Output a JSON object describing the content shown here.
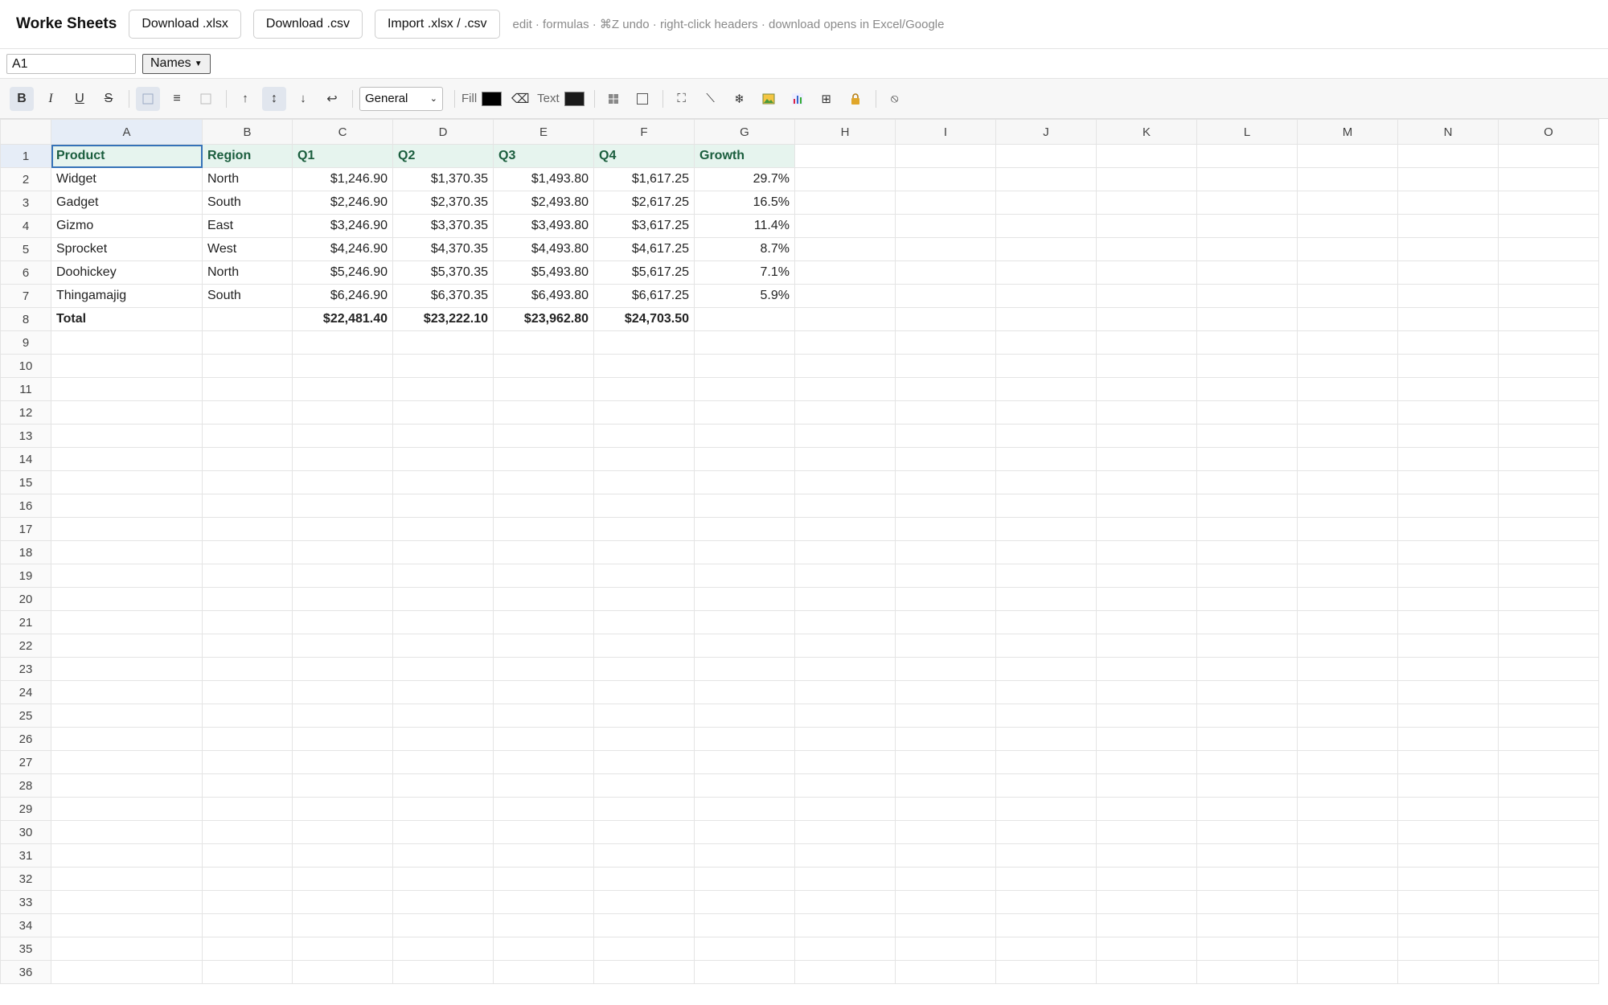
{
  "app": {
    "title": "Worke Sheets",
    "buttons": [
      "Download .xlsx",
      "Download .csv",
      "Import .xlsx / .csv"
    ],
    "hint": "edit · formulas · ⌘Z undo · right-click headers · download opens in Excel/Google"
  },
  "namebar": {
    "cell_ref": "A1",
    "names_label": "Names"
  },
  "toolbar": {
    "bold": "B",
    "italic": "I",
    "underline": "U",
    "strike": "S",
    "format_value": "General",
    "fill_label": "Fill",
    "text_label": "Text",
    "fill_color": "#000000",
    "text_color": "#1a1a1a"
  },
  "grid": {
    "columns": [
      "A",
      "B",
      "C",
      "D",
      "E",
      "F",
      "G",
      "H",
      "I",
      "J",
      "K",
      "L",
      "M",
      "N",
      "O"
    ],
    "row_count": 36,
    "data": [
      [
        "Product",
        "Region",
        "Q1",
        "Q2",
        "Q3",
        "Q4",
        "Growth"
      ],
      [
        "Widget",
        "North",
        "$1,246.90",
        "$1,370.35",
        "$1,493.80",
        "$1,617.25",
        "29.7%"
      ],
      [
        "Gadget",
        "South",
        "$2,246.90",
        "$2,370.35",
        "$2,493.80",
        "$2,617.25",
        "16.5%"
      ],
      [
        "Gizmo",
        "East",
        "$3,246.90",
        "$3,370.35",
        "$3,493.80",
        "$3,617.25",
        "11.4%"
      ],
      [
        "Sprocket",
        "West",
        "$4,246.90",
        "$4,370.35",
        "$4,493.80",
        "$4,617.25",
        "8.7%"
      ],
      [
        "Doohickey",
        "North",
        "$5,246.90",
        "$5,370.35",
        "$5,493.80",
        "$5,617.25",
        "7.1%"
      ],
      [
        "Thingamajig",
        "South",
        "$6,246.90",
        "$6,370.35",
        "$6,493.80",
        "$6,617.25",
        "5.9%"
      ],
      [
        "Total",
        "",
        "$22,481.40",
        "$23,222.10",
        "$23,962.80",
        "$24,703.50",
        ""
      ]
    ],
    "header_fill": "#e6f4ee",
    "selection_color": "#3572b8"
  }
}
